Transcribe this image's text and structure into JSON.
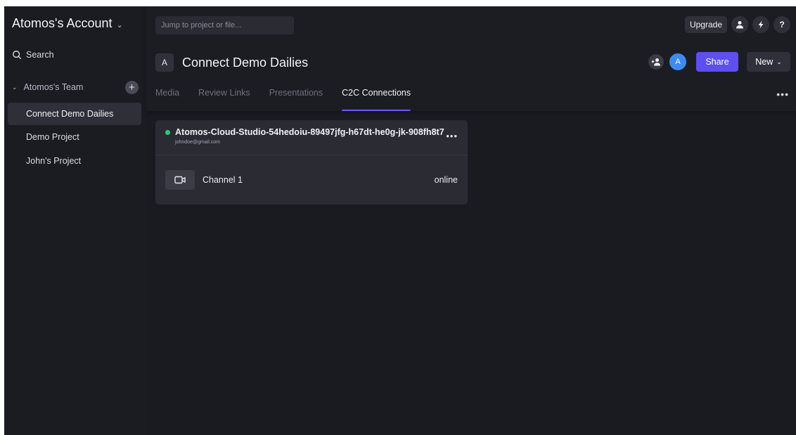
{
  "sidebar": {
    "account_title": "Atomos's Account",
    "search_label": "Search",
    "team_label": "Atomos's Team",
    "projects": [
      "Connect Demo Dailies",
      "Demo Project",
      "John's Project"
    ]
  },
  "topbar": {
    "search_placeholder": "Jump to project or file...",
    "upgrade_label": "Upgrade",
    "help_label": "?"
  },
  "project": {
    "badge": "A",
    "name": "Connect Demo Dailies",
    "avatar_initial": "A",
    "share_label": "Share",
    "new_label": "New"
  },
  "tabs": [
    "Media",
    "Review Links",
    "Presentations",
    "C2C Connections"
  ],
  "active_tab": "C2C Connections",
  "connection": {
    "name": "Atomos-Cloud-Studio-54hedoiu-89497jfg-h67dt-he0g-jk-908fh8t7",
    "email": "johndoe@gmail.com",
    "status_color": "#2ecc71",
    "channel_name": "Channel 1",
    "channel_status": "online"
  },
  "colors": {
    "accent": "#5d4ff0",
    "avatar": "#3d8bef"
  }
}
